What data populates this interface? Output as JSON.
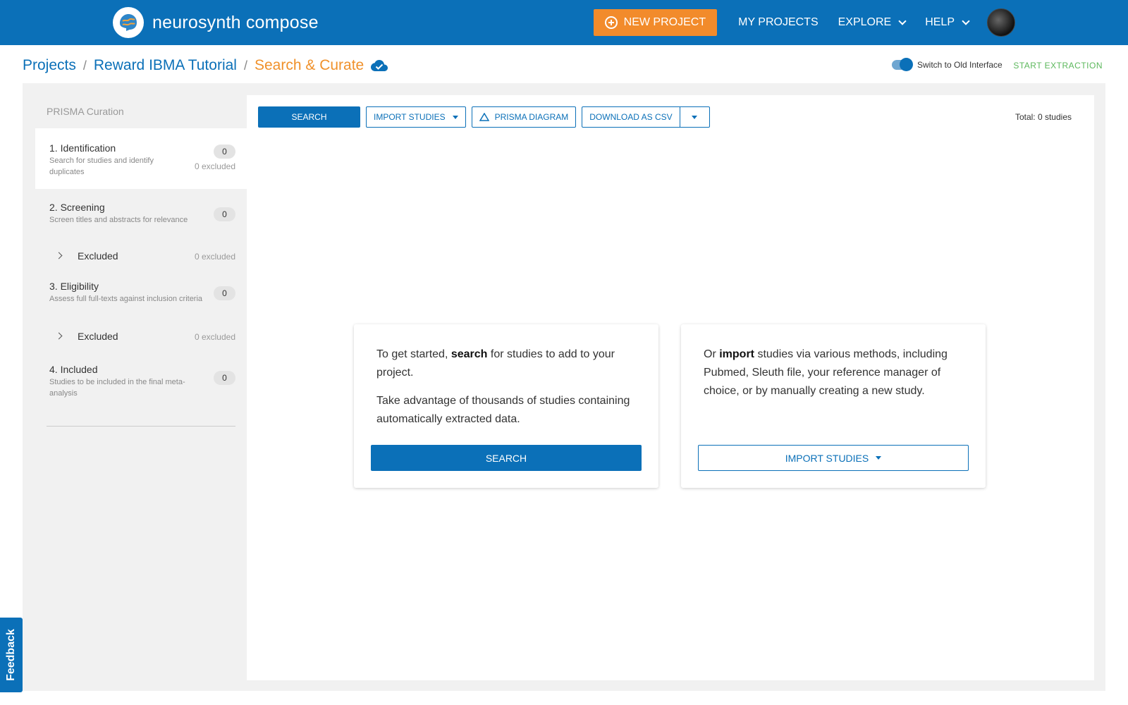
{
  "header": {
    "brand": "neurosynth compose",
    "new_project": "NEW PROJECT",
    "my_projects": "MY PROJECTS",
    "explore": "EXPLORE",
    "help": "HELP"
  },
  "breadcrumb": {
    "projects": "Projects",
    "project": "Reward IBMA Tutorial",
    "current": "Search & Curate",
    "sep": "/"
  },
  "toolbar_top": {
    "switch_label": "Switch to Old Interface",
    "start_extraction": "START EXTRACTION"
  },
  "sidebar": {
    "title": "PRISMA Curation",
    "steps": [
      {
        "title": "1. Identification",
        "desc": "Search for studies and identify duplicates",
        "count": "0",
        "excluded": "0 excluded"
      },
      {
        "title": "2. Screening",
        "desc": "Screen titles and abstracts for relevance",
        "count": "0"
      },
      {
        "title": "3. Eligibility",
        "desc": "Assess full full-texts against inclusion criteria",
        "count": "0"
      },
      {
        "title": "4. Included",
        "desc": "Studies to be included in the final meta-analysis",
        "count": "0"
      }
    ],
    "excluded_rows": [
      {
        "label": "Excluded",
        "count": "0 excluded"
      },
      {
        "label": "Excluded",
        "count": "0 excluded"
      }
    ]
  },
  "toolbar": {
    "search": "SEARCH",
    "import": "IMPORT STUDIES",
    "prisma": "PRISMA DIAGRAM",
    "download": "DOWNLOAD AS CSV",
    "total": "Total: 0 studies"
  },
  "cards": {
    "left": {
      "pre": "To get started, ",
      "bold": "search",
      "post": " for studies to add to your project.",
      "para2": "Take advantage of thousands of studies containing automatically extracted data.",
      "button": "SEARCH"
    },
    "right": {
      "pre": "Or ",
      "bold": "import",
      "post": " studies via various methods, including Pubmed, Sleuth file, your reference manager of choice, or by manually creating a new study.",
      "button": "IMPORT STUDIES"
    }
  },
  "feedback": "Feedback",
  "colors": {
    "primary": "#0b70b8",
    "accent": "#f28b2b",
    "success": "#5cb85c"
  }
}
